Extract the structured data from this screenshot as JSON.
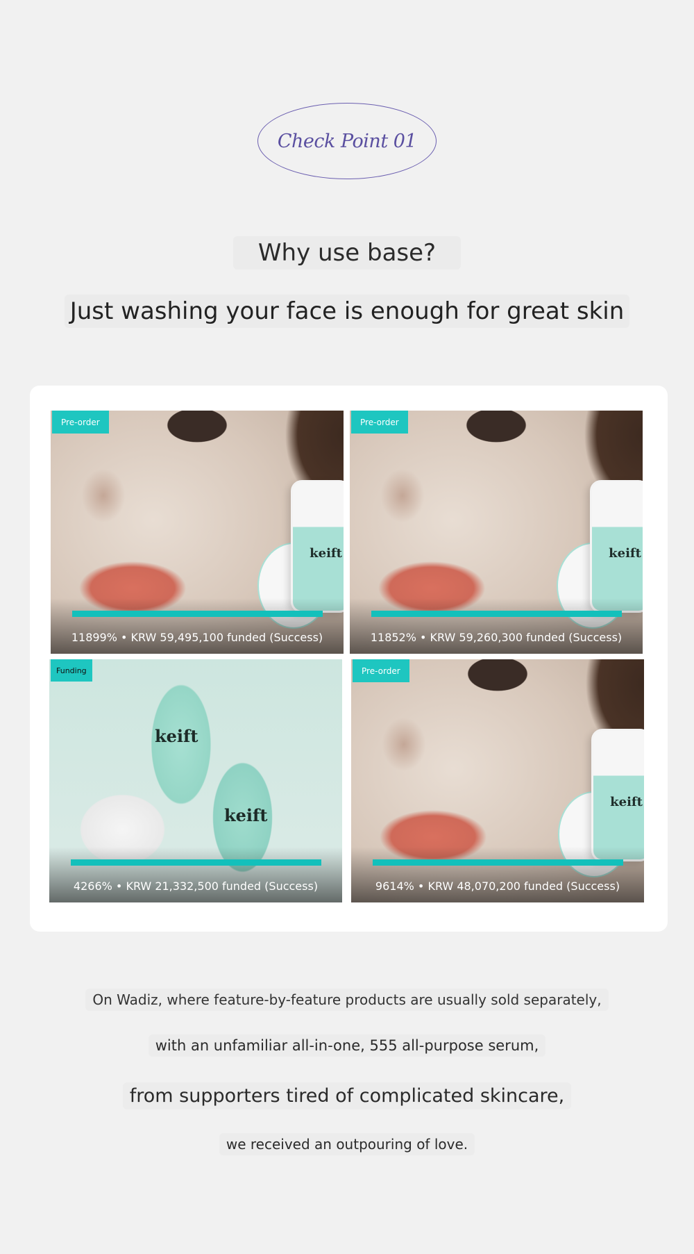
{
  "badge": {
    "label": "Check Point 01"
  },
  "headings": {
    "question": "Why use base?",
    "statement": "Just washing your face is enough for great skin"
  },
  "tiles": [
    {
      "tag": "Pre-order",
      "caption": "11899% • KRW 59,495,100 funded (Success)",
      "image": "face-with-serum"
    },
    {
      "tag": "Pre-order",
      "caption": "11852% • KRW 59,260,300 funded (Success)",
      "image": "face-with-serum"
    },
    {
      "tag": "Funding",
      "caption": "4266% • KRW 21,332,500 funded (Success)",
      "image": "serum-bottles"
    },
    {
      "tag": "Pre-order",
      "caption": "9614% • KRW 48,070,200 funded (Success)",
      "image": "face-with-serum"
    }
  ],
  "product_logo": "keift",
  "paragraph": [
    "On Wadiz, where feature-by-feature products are usually sold separately,",
    "with an unfamiliar all-in-one, 555 all-purpose serum,",
    "from supporters tired of complicated skincare,",
    "we received an outpouring of love."
  ],
  "colors": {
    "accent_teal": "#1ec6c0",
    "badge_purple": "#5a4fa0",
    "background": "#f1f1f1"
  }
}
